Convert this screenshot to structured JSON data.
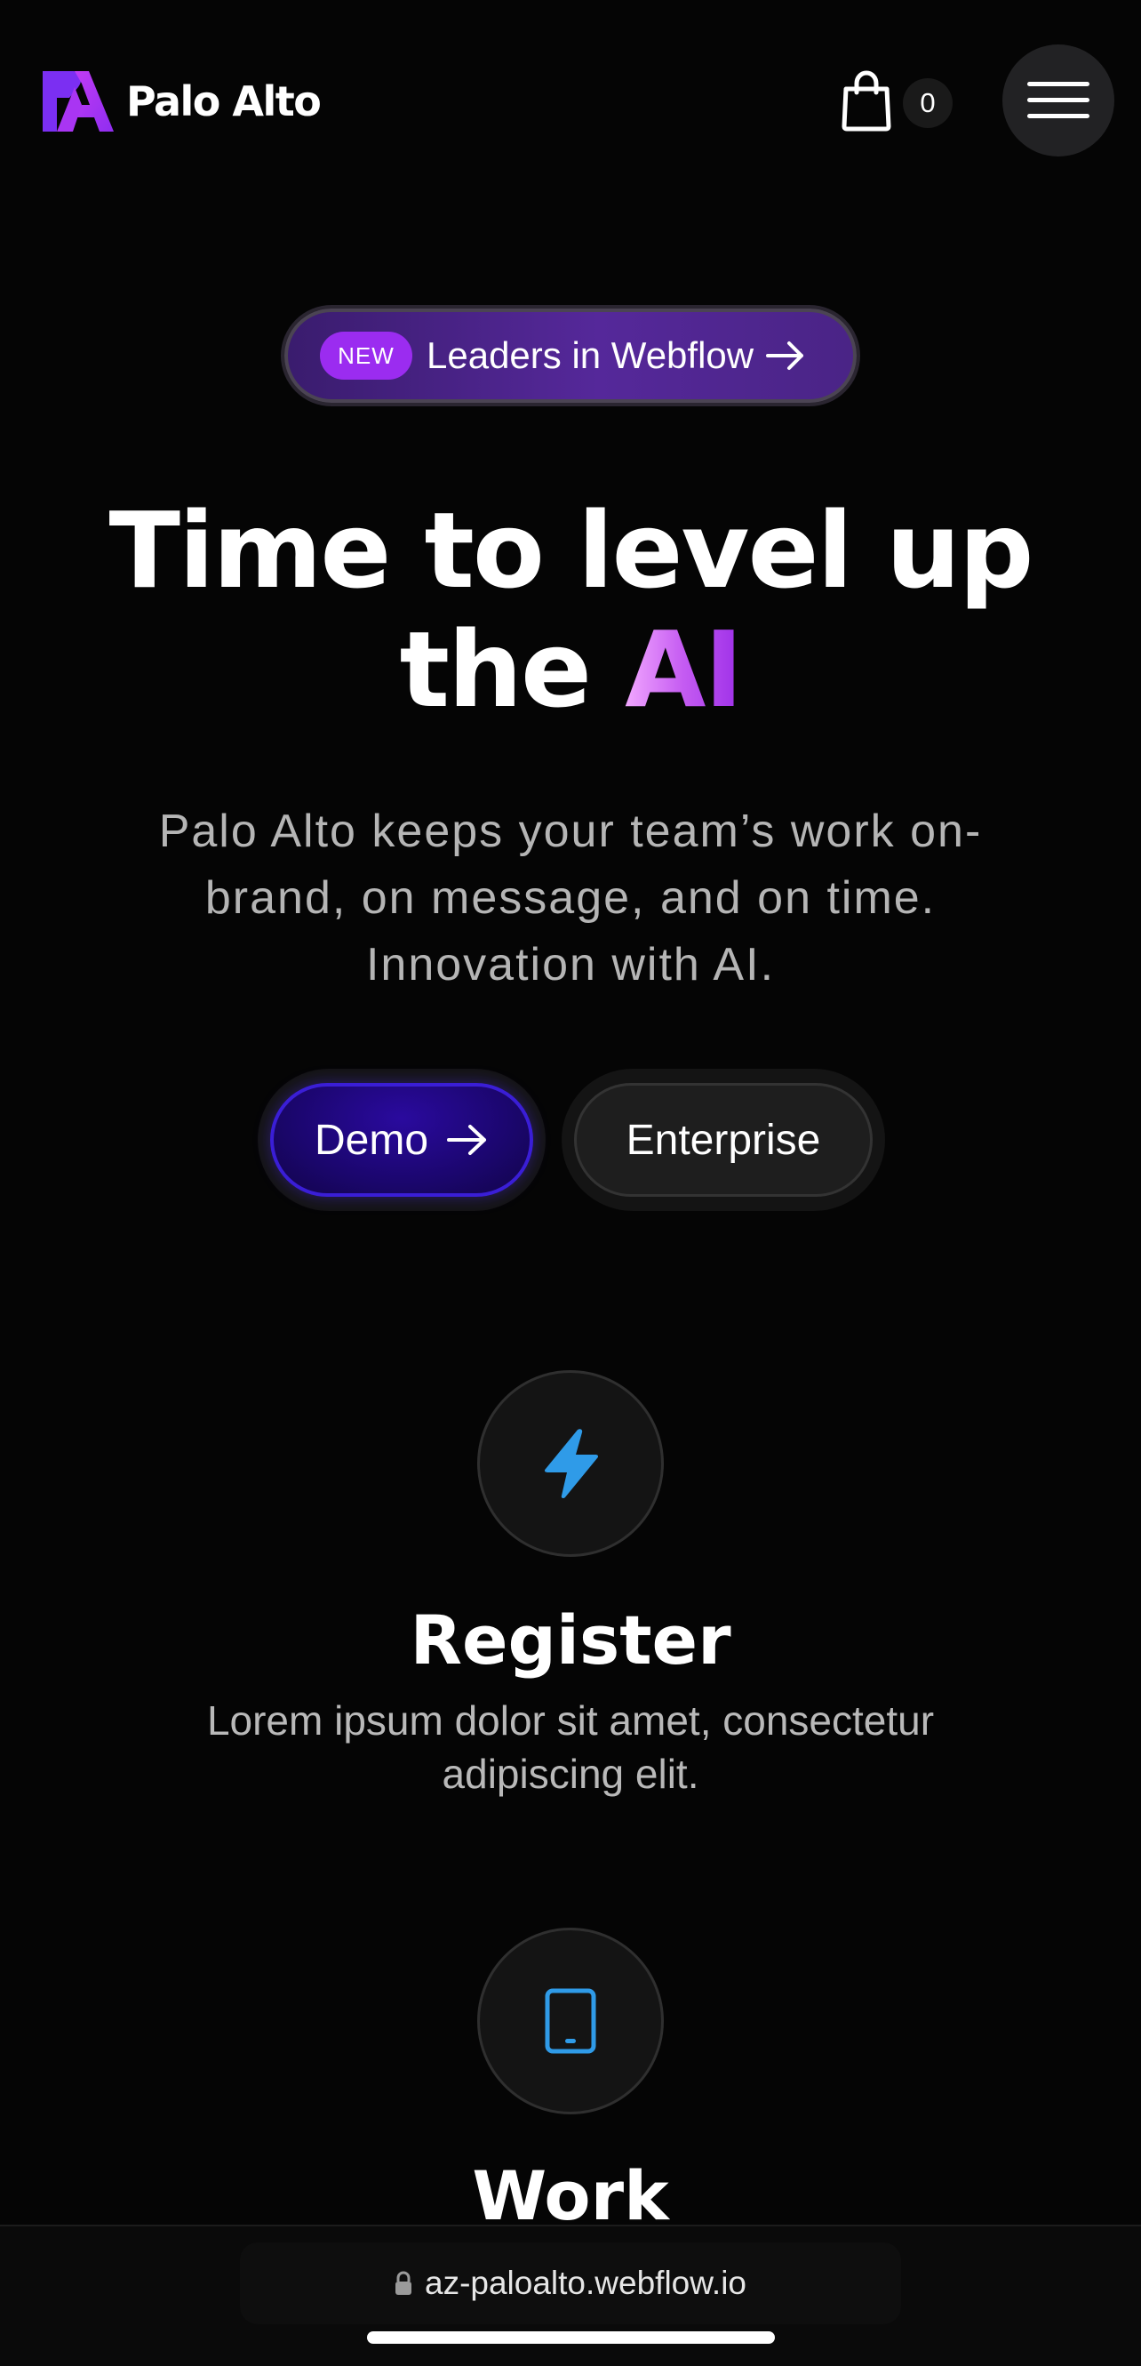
{
  "header": {
    "brand_name": "Palo Alto",
    "logo_icon": "palo-alto-logo-icon",
    "cart_icon": "shopping-bag-icon",
    "cart_count": "0",
    "menu_icon": "hamburger-menu-icon"
  },
  "hero": {
    "badge_tag": "NEW",
    "badge_label": "Leaders in Webflow",
    "headline_main": "Time to level up the ",
    "headline_accent": "AI",
    "subtext": "Palo Alto keeps your team’s work on-brand, on message, and on time. Innovation with AI.",
    "primary_button": "Demo",
    "secondary_button": "Enterprise"
  },
  "features": [
    {
      "icon": "lightning-bolt-icon",
      "title": "Register",
      "description": "Lorem ipsum dolor sit amet, consectetur adipiscing elit."
    },
    {
      "icon": "tablet-icon",
      "title": "Work"
    }
  ],
  "browser": {
    "url": "az-paloalto.webflow.io"
  },
  "colors": {
    "background": "#050505",
    "brand_purple": "#9b2cf0",
    "accent_gradient_start": "#f2a8ff",
    "accent_gradient_end": "#9d2fe8",
    "demo_button_blue": "#1b066e",
    "feature_icon_blue": "#2f9be8"
  }
}
